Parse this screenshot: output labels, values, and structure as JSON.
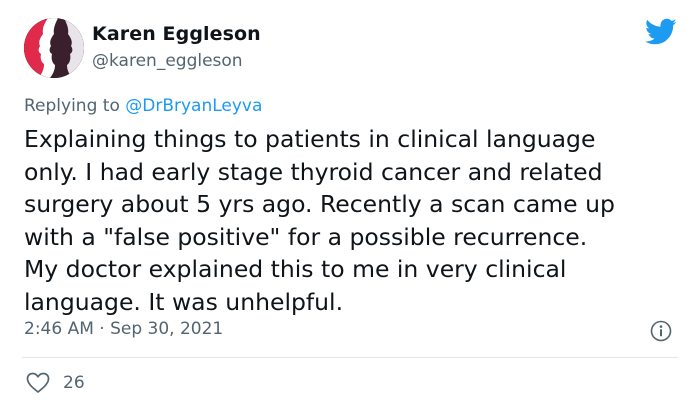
{
  "author": {
    "name": "Karen Eggleson",
    "handle": "@karen_eggleson"
  },
  "reply": {
    "prefix": "Replying to ",
    "mention": "@DrBryanLeyva"
  },
  "tweet": {
    "text": "Explaining things to patients in clinical language\nonly. I had early stage thyroid cancer and related\nsurgery about 5 yrs ago. Recently a scan came up\nwith a \"false positive\" for a possible recurrence.\nMy doctor explained this to me in very clinical\nlanguage. It was unhelpful.",
    "timestamp": "2:46 AM · Sep 30, 2021"
  },
  "engagement": {
    "likes": "26"
  },
  "icons": {
    "brand": "twitter-bird-icon",
    "info": "info-icon",
    "like": "heart-icon"
  },
  "colors": {
    "brand_blue": "#1d9bf0",
    "muted_text": "#536471",
    "avatar_red": "#e0294b"
  }
}
